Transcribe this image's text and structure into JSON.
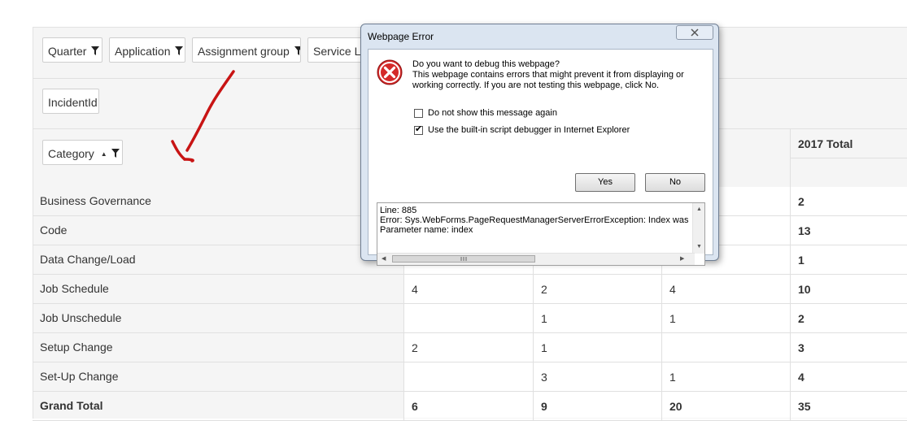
{
  "filters": {
    "row1": [
      "Quarter",
      "Application",
      "Assignment group",
      "Service Le"
    ],
    "row2": [
      "IncidentId"
    ],
    "category": "Category"
  },
  "pivot": {
    "total_header": "2017 Total",
    "rows": [
      {
        "label": "Business Governance",
        "values": [
          "",
          "",
          "",
          "2"
        ]
      },
      {
        "label": "Code",
        "values": [
          "",
          "",
          "",
          "13"
        ]
      },
      {
        "label": "Data Change/Load",
        "values": [
          "",
          "",
          "",
          "1"
        ]
      },
      {
        "label": "Job Schedule",
        "values": [
          "4",
          "2",
          "4",
          "10"
        ]
      },
      {
        "label": "Job Unschedule",
        "values": [
          "",
          "1",
          "1",
          "2"
        ]
      },
      {
        "label": "Setup Change",
        "values": [
          "2",
          "1",
          "",
          "3"
        ]
      },
      {
        "label": "Set-Up Change",
        "values": [
          "",
          "3",
          "1",
          "4"
        ]
      },
      {
        "label": "Grand Total",
        "values": [
          "6",
          "9",
          "20",
          "35"
        ]
      }
    ]
  },
  "dialog": {
    "title": "Webpage Error",
    "question": "Do you want to debug this webpage?",
    "message_line1": "This webpage contains errors that might prevent it from displaying or",
    "message_line2": "working correctly. If you are not testing this webpage, click No.",
    "checkbox1": "Do not show this message again",
    "checkbox1_checked": false,
    "checkbox2": "Use the built-in script debugger in Internet Explorer",
    "checkbox2_checked": true,
    "yes_label": "Yes",
    "no_label": "No",
    "error_line1": "Line: 885",
    "error_line2": "Error: Sys.WebForms.PageRequestManagerServerErrorException: Index was",
    "error_line3": "Parameter name: index"
  },
  "colors": {
    "arrow": "#c81414",
    "error_icon": "#d42a2a",
    "dialog_frame": "#dbe5f1"
  },
  "icons": [
    "funnel-icon",
    "sort-asc-icon",
    "error-icon",
    "close-icon",
    "checkmark-icon"
  ]
}
